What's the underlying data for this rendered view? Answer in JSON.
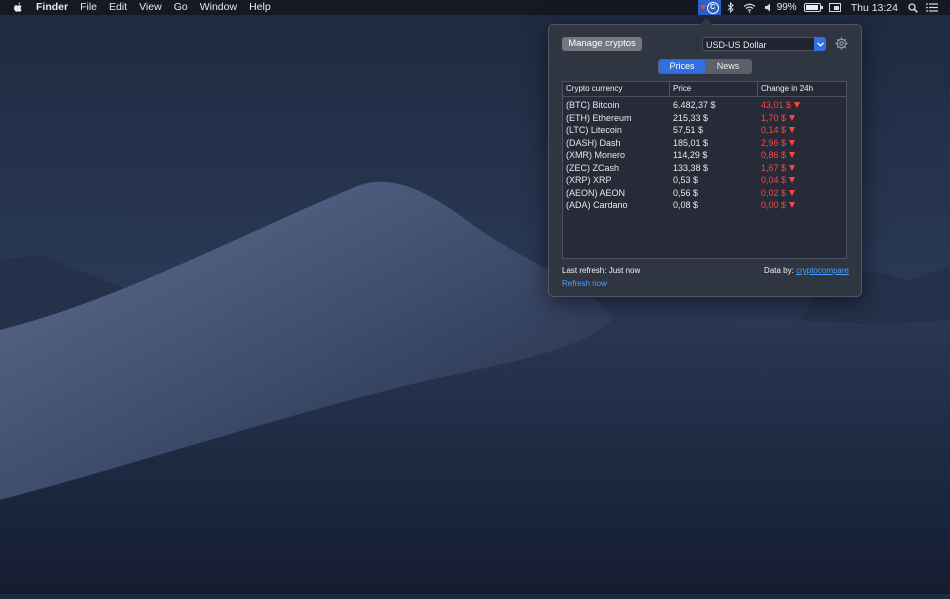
{
  "menubar": {
    "app": "Finder",
    "menus": [
      "File",
      "Edit",
      "View",
      "Go",
      "Window",
      "Help"
    ],
    "battery": "99%",
    "clock": "Thu 13:24"
  },
  "popover": {
    "manage_label": "Manage cryptos",
    "currency": "USD-US Dollar",
    "tabs": [
      "Prices",
      "News"
    ],
    "active_tab": "Prices",
    "columns": [
      "Crypto currency",
      "Price",
      "Change in 24h"
    ],
    "rows": [
      {
        "name": "(BTC) Bitcoin",
        "price": "6.482,37 $",
        "change": "43,01 $"
      },
      {
        "name": "(ETH) Ethereum",
        "price": "215,33 $",
        "change": "1,70 $"
      },
      {
        "name": "(LTC) Litecoin",
        "price": "57,51 $",
        "change": "0,14 $"
      },
      {
        "name": "(DASH) Dash",
        "price": "185,01 $",
        "change": "2,96 $"
      },
      {
        "name": "(XMR) Monero",
        "price": "114,29 $",
        "change": "0,86 $"
      },
      {
        "name": "(ZEC) ZCash",
        "price": "133,38 $",
        "change": "1,67 $"
      },
      {
        "name": "(XRP) XRP",
        "price": "0,53 $",
        "change": "0,04 $"
      },
      {
        "name": "(AEON) AEON",
        "price": "0,56 $",
        "change": "0,02 $"
      },
      {
        "name": "(ADA) Cardano",
        "price": "0,08 $",
        "change": "0,00 $"
      }
    ],
    "last_refresh": "Last refresh: Just now",
    "refresh_now": "Refresh now",
    "data_by": "Data by:",
    "data_source": "cryptocompare"
  },
  "colors": {
    "accent": "#2f6fe0",
    "negative": "#ff4444",
    "link": "#4aa0ff"
  }
}
